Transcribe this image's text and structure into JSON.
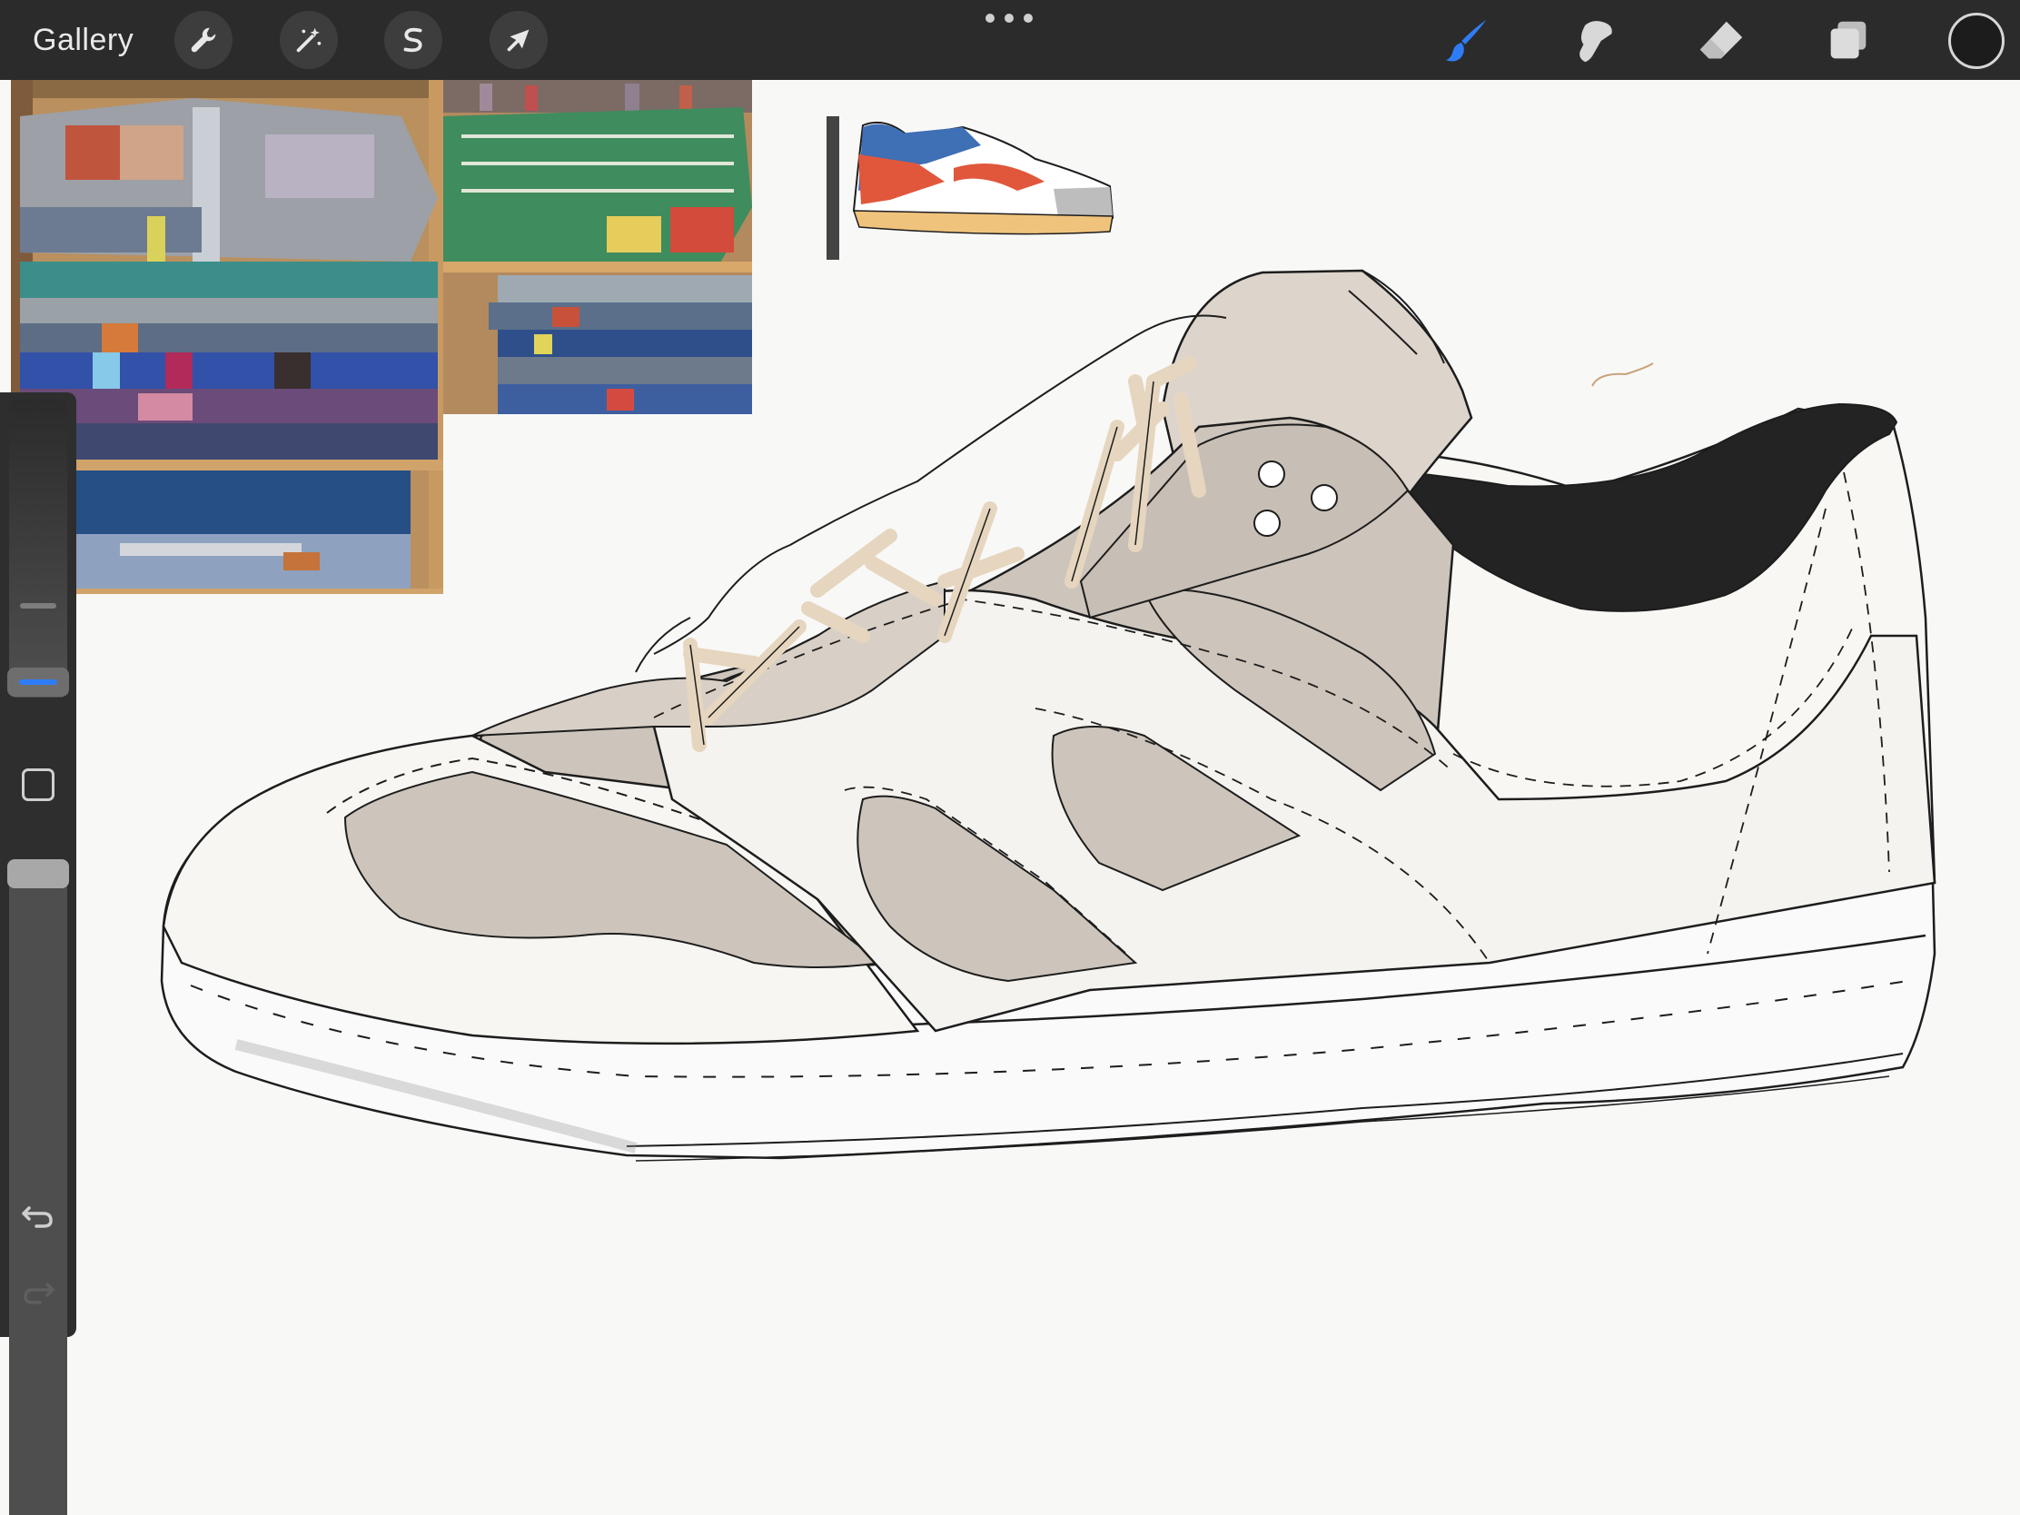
{
  "toolbar": {
    "gallery_label": "Gallery",
    "left_tools": [
      {
        "name": "actions",
        "icon": "wrench-icon"
      },
      {
        "name": "adjustments",
        "icon": "magic-wand-icon"
      },
      {
        "name": "selection",
        "icon": "selection-s-icon"
      },
      {
        "name": "transform",
        "icon": "arrow-cursor-icon"
      }
    ],
    "more_icon": "more-dots-icon",
    "right_tools": [
      {
        "name": "brush",
        "icon": "brush-icon",
        "active": true
      },
      {
        "name": "smudge",
        "icon": "smudge-icon",
        "active": false
      },
      {
        "name": "eraser",
        "icon": "eraser-icon",
        "active": false
      },
      {
        "name": "layers",
        "icon": "layers-icon",
        "active": false
      }
    ],
    "current_color": "#1c1c1c"
  },
  "sidebar": {
    "brush_size_icon": "size-slider",
    "opacity_icon": "opacity-slider",
    "modify_icon": "square-modify-icon",
    "undo_icon": "undo-icon",
    "redo_icon": "redo-icon",
    "accent_color": "#2f7df6"
  },
  "canvas": {
    "background": "#f8f8f7",
    "references": [
      {
        "name": "folded-blankets-shelf-photo"
      },
      {
        "name": "green-blanket-shelf-photo"
      },
      {
        "name": "colored-sneaker-thumbnail"
      }
    ],
    "colors": {
      "upper_tan": "#cdc5bc",
      "upper_light": "#f5f3ef",
      "collar": "#242424",
      "laces": "#e6d6bf",
      "tongue": "#ddd5cc",
      "sole": "#fafafa",
      "outline": "#1d1d1d"
    }
  }
}
